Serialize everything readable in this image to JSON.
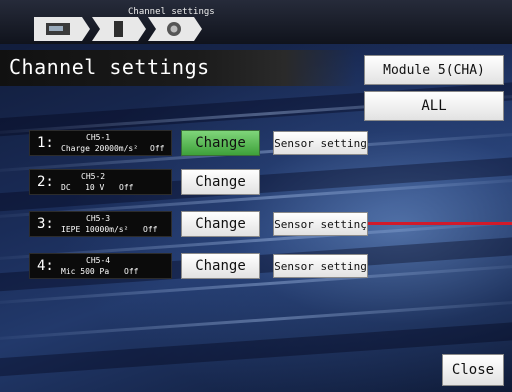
{
  "topbar": {
    "title": "Channel settings",
    "breadcrumb_icons": [
      "recorder-icon",
      "module-icon",
      "sensor-icon"
    ]
  },
  "header": {
    "title": "Channel settings"
  },
  "module_button": {
    "label": "Module  5(CHA)"
  },
  "all_button": {
    "label": "ALL"
  },
  "channels": [
    {
      "num": "1:",
      "name": "CH5-1",
      "desc": "Charge 20000m/s²",
      "state": "Off",
      "change_label": "Change",
      "change_selected": true,
      "sensor_label": "Sensor setting"
    },
    {
      "num": "2:",
      "name": "CH5-2",
      "desc": "DC   10 V",
      "state": "Off",
      "change_label": "Change",
      "change_selected": false,
      "sensor_label": ""
    },
    {
      "num": "3:",
      "name": "CH5-3",
      "desc": "IEPE 10000m/s²",
      "state": "Off",
      "change_label": "Change",
      "change_selected": false,
      "sensor_label": "Sensor settinç"
    },
    {
      "num": "4:",
      "name": "CH5-4",
      "desc": "Mic 500 Pa",
      "state": "Off",
      "change_label": "Change",
      "change_selected": false,
      "sensor_label": "Sensor setting"
    }
  ],
  "close_button": {
    "label": "Close"
  },
  "colors": {
    "selected": "#5cbf57",
    "annotation_line": "#d11a2a"
  }
}
